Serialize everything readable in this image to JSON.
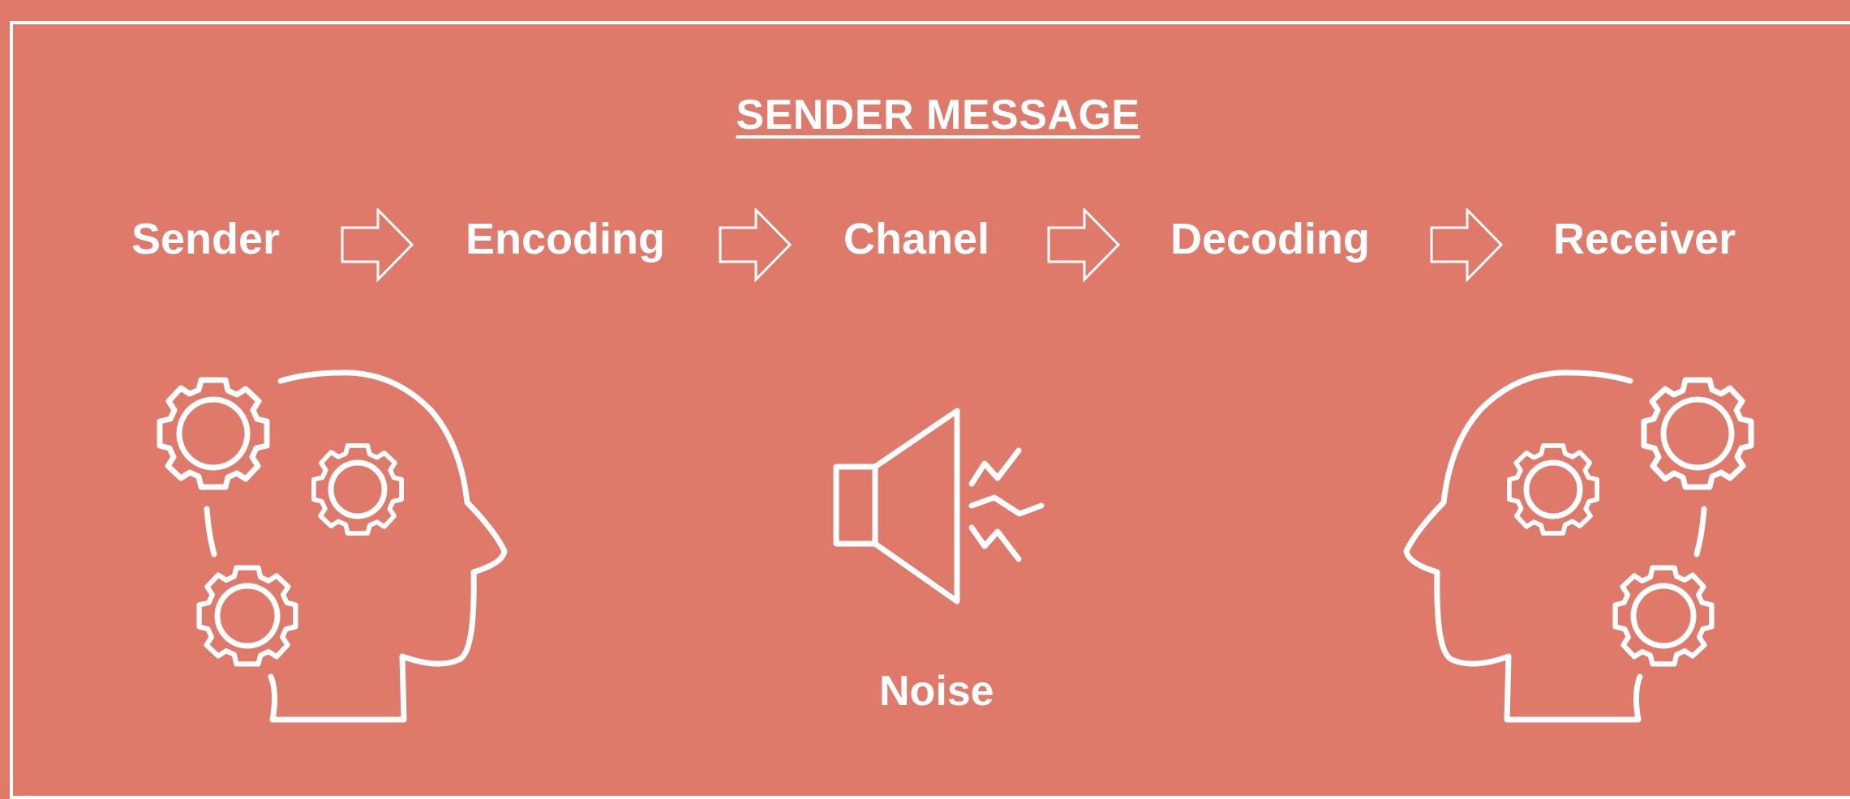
{
  "title": "SENDER MESSAGE",
  "steps": {
    "sender": "Sender",
    "encoding": "Encoding",
    "chanel": "Chanel",
    "decoding": "Decoding",
    "receiver": "Receiver"
  },
  "noise_label": "Noise",
  "icons": {
    "arrows": "outline-right-arrow-icon",
    "sender_head": "head-with-gears-icon",
    "receiver_head": "head-with-gears-icon",
    "noise": "speaker-with-sound-waves-icon"
  },
  "colors": {
    "background": "#df7a6b",
    "foreground": "#ffffff"
  }
}
